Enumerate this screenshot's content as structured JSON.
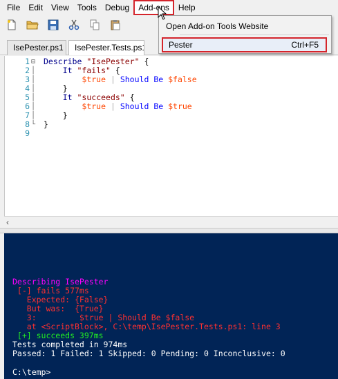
{
  "menubar": {
    "items": [
      "File",
      "Edit",
      "View",
      "Tools",
      "Debug",
      "Add-ons",
      "Help"
    ]
  },
  "toolbar": {
    "buttons": [
      "new-file-icon",
      "open-folder-icon",
      "save-icon",
      "cut-icon",
      "copy-icon",
      "paste-icon"
    ]
  },
  "tabs": [
    {
      "label": "IsePester.ps1"
    },
    {
      "label": "IsePester.Tests.ps1"
    }
  ],
  "editor": {
    "line_numbers": [
      "1",
      "2",
      "3",
      "4",
      "5",
      "6",
      "7",
      "8",
      "9"
    ]
  },
  "addons_menu": {
    "items": [
      {
        "label": "Open Add-on Tools Website",
        "shortcut": ""
      },
      {
        "label": "Pester",
        "shortcut": "Ctrl+F5"
      }
    ]
  },
  "console": {
    "lines": {
      "describing": "Describing IsePester",
      "fails": " [-] fails 577ms",
      "expected": "   Expected: {False}",
      "butwas": "   But was:  {True}",
      "line3": "   3:         $true | Should Be $false",
      "at": "   at <ScriptBlock>, C:\\temp\\IsePester.Tests.ps1: line 3",
      "succeeds": " [+] succeeds 397ms",
      "completed": "Tests completed in 974ms",
      "summary": "Passed: 1 Failed: 1 Skipped: 0 Pending: 0 Inconclusive: 0"
    },
    "prompt": "C:\\temp>"
  },
  "colors": {
    "console_bg": "#012456",
    "highlight_red": "#d4242b"
  }
}
